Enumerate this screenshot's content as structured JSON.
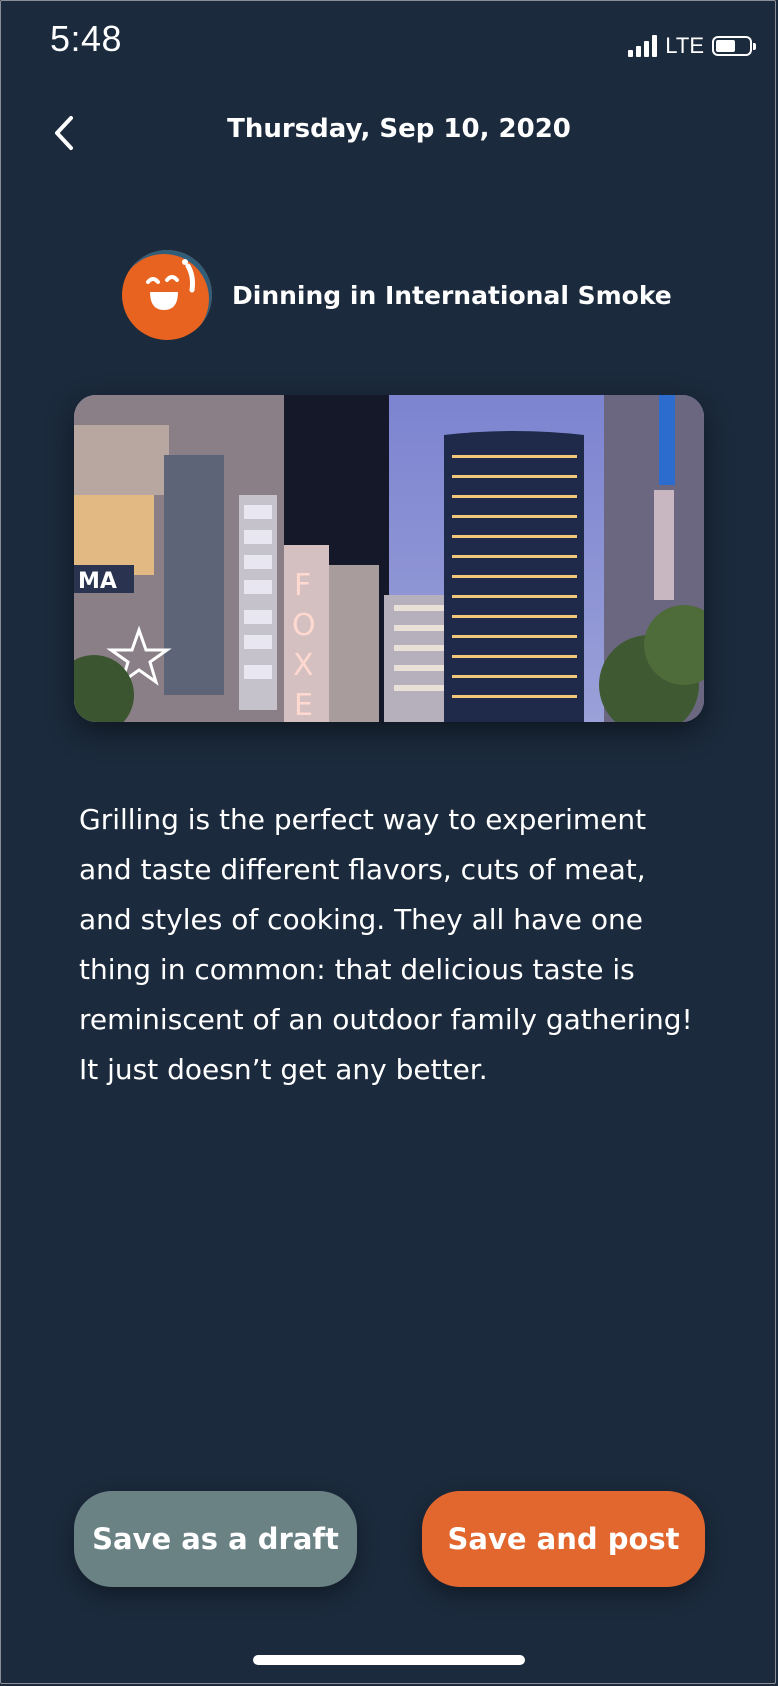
{
  "status_bar": {
    "time": "5:48",
    "network": "LTE",
    "icons": [
      "signal-icon",
      "battery-icon"
    ]
  },
  "header": {
    "title": "Thursday, Sep 10, 2020",
    "back_icon": "chevron-left-icon"
  },
  "author": {
    "name": "Dinning in International Smoke",
    "avatar_icon": "smiley-face-icon",
    "avatar_color": "#e8631f"
  },
  "post": {
    "image_description_icon": "city-street-photo",
    "body_lines": [
      "Grilling is the perfect way to experiment",
      "and taste different flavors, cuts of meat,",
      "and styles of cooking. They all have one",
      "thing in common: that delicious taste is",
      "reminiscent of an outdoor family gathering!",
      "It just doesn’t get any better."
    ]
  },
  "actions": {
    "draft_label": "Save as a draft",
    "post_label": "Save and post",
    "draft_color": "#6b8285",
    "post_color": "#e2672f"
  },
  "colors": {
    "background": "#1b2a3c",
    "text": "#ffffff"
  }
}
